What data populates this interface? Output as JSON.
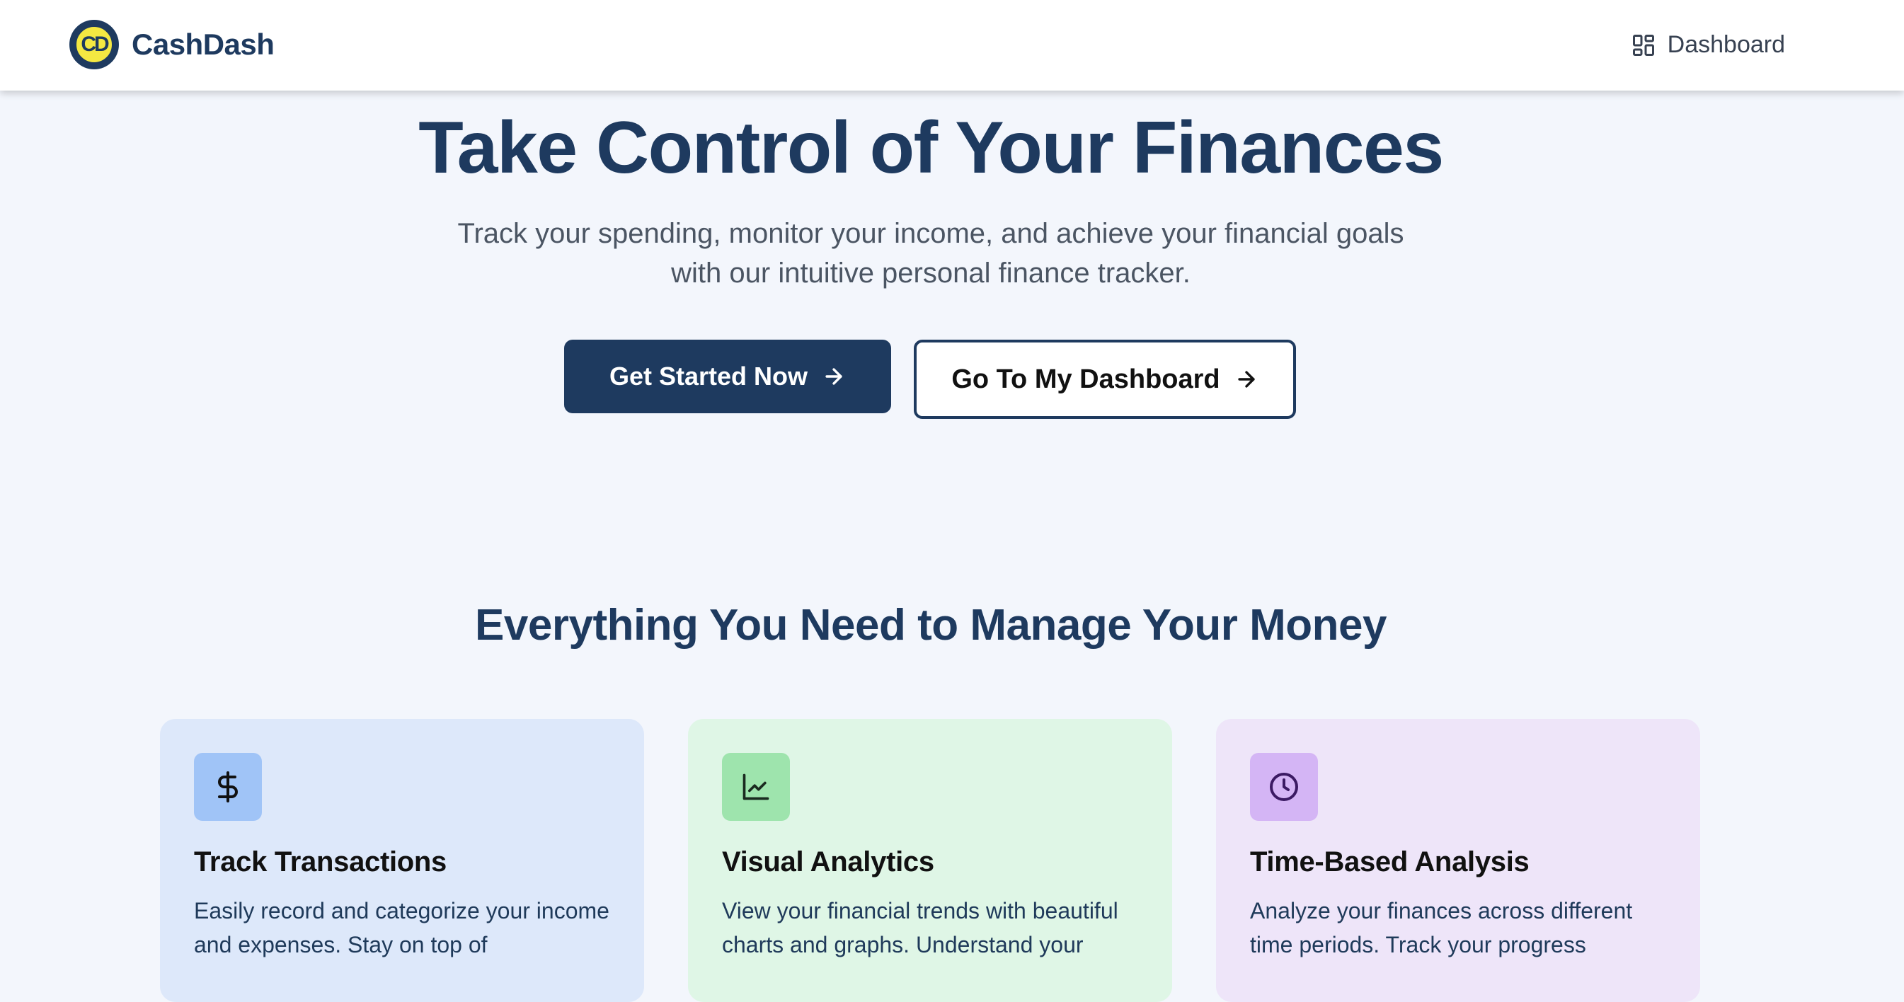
{
  "header": {
    "logo_text": "CD",
    "brand": "CashDash",
    "nav_dashboard": "Dashboard",
    "nav_icon": "grid-icon"
  },
  "hero": {
    "title": "Take Control of Your Finances",
    "subtitle": "Track your spending, monitor your income, and achieve your financial goals with our intuitive personal finance tracker.",
    "primary_button": "Get Started Now",
    "secondary_button": "Go To My Dashboard"
  },
  "features": {
    "title": "Everything You Need to Manage Your Money",
    "cards": [
      {
        "icon": "dollar-icon",
        "title": "Track Transactions",
        "description": "Easily record and categorize your income and expenses. Stay on top of"
      },
      {
        "icon": "chart-icon",
        "title": "Visual Analytics",
        "description": "View your financial trends with beautiful charts and graphs. Understand your"
      },
      {
        "icon": "clock-icon",
        "title": "Time-Based Analysis",
        "description": "Analyze your finances across different time periods. Track your progress"
      }
    ]
  },
  "colors": {
    "primary": "#1e3a5f",
    "logo_yellow": "#f4e842",
    "page_bg": "#f3f6fc",
    "card_blue": "#dde8fa",
    "card_green": "#dff6e6",
    "card_purple": "#eee5f9"
  }
}
